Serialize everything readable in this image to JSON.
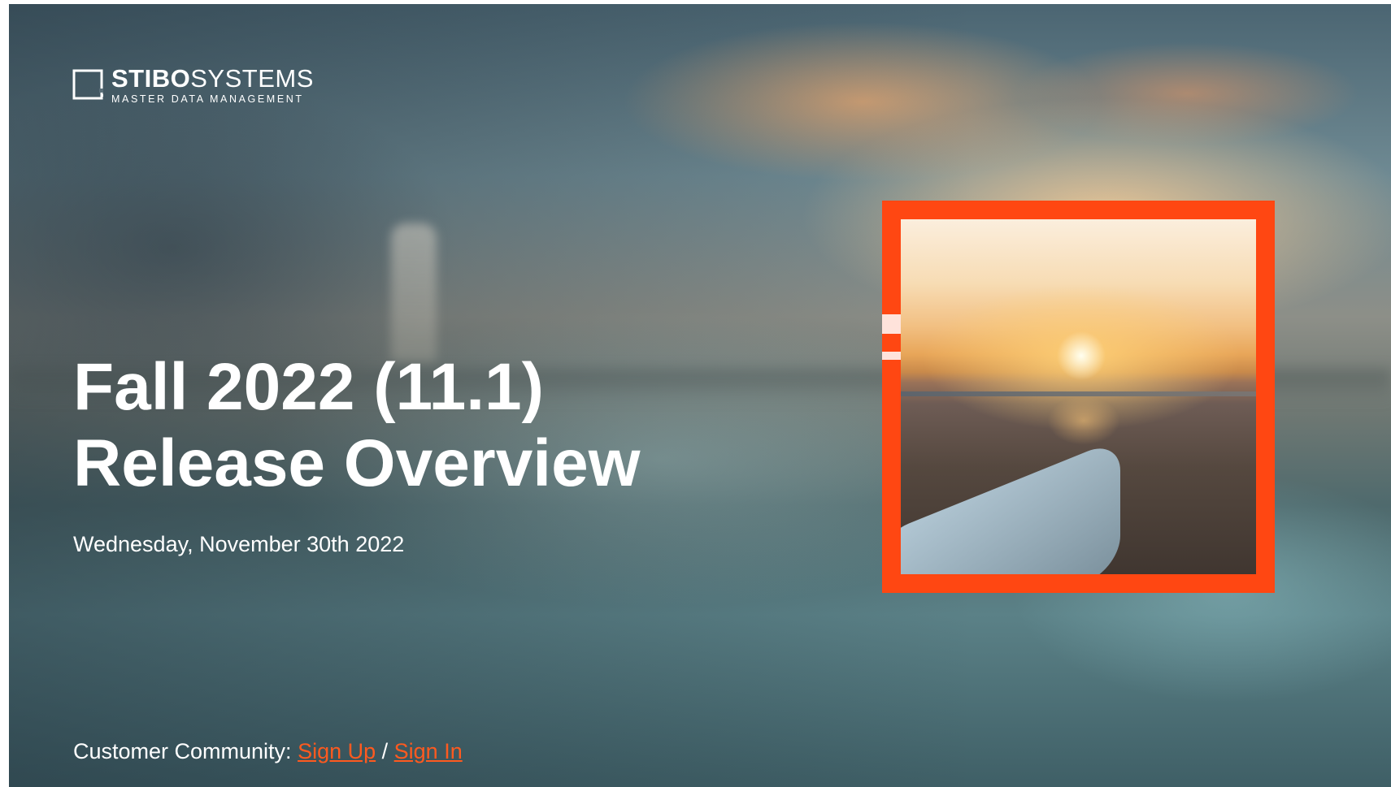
{
  "logo": {
    "brand_bold": "STIBO",
    "brand_light": "SYSTEMS",
    "tagline": "MASTER DATA MANAGEMENT"
  },
  "slide": {
    "title_line1": "Fall 2022 (11.1)",
    "title_line2": "Release Overview",
    "date": "Wednesday, November 30th 2022"
  },
  "community": {
    "label": "Customer Community: ",
    "signup": "Sign Up",
    "separator": " / ",
    "signin": "Sign In"
  },
  "colors": {
    "accent": "#ff4712",
    "link": "#ff5a1f",
    "text": "#ffffff"
  }
}
